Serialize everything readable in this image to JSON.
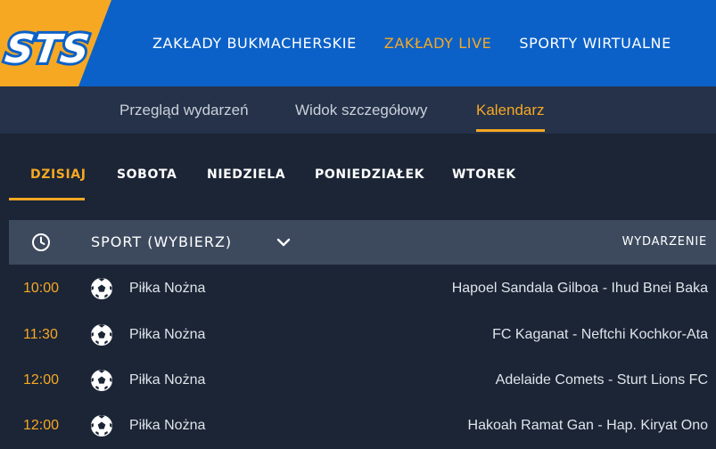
{
  "header": {
    "logo_text": "STS",
    "nav": [
      {
        "label": "ZAKŁADY BUKMACHERSKIE",
        "active": false
      },
      {
        "label": "ZAKŁADY LIVE",
        "active": true
      },
      {
        "label": "SPORTY WIRTUALNE",
        "active": false
      }
    ],
    "colors": {
      "brand_blue": "#0b61c8",
      "accent": "#f7a823"
    }
  },
  "subnav": {
    "items": [
      {
        "label": "Przegląd wydarzeń",
        "active": false
      },
      {
        "label": "Widok szczegółowy",
        "active": false
      },
      {
        "label": "Kalendarz",
        "active": true
      }
    ]
  },
  "days": {
    "tabs": [
      {
        "label": "DZISIAJ",
        "active": true
      },
      {
        "label": "SOBOTA",
        "active": false
      },
      {
        "label": "NIEDZIELA",
        "active": false
      },
      {
        "label": "PONIEDZIAŁEK",
        "active": false
      },
      {
        "label": "WTOREK",
        "active": false
      }
    ]
  },
  "table": {
    "time_icon": "clock-icon",
    "sport_select": "SPORT (WYBIERZ)",
    "event_header": "WYDARZENIE",
    "rows": [
      {
        "time": "10:00",
        "icon": "soccer-ball-icon",
        "sport": "Piłka Nożna",
        "match": "Hapoel Sandala Gilboa - Ihud Bnei Baka"
      },
      {
        "time": "11:30",
        "icon": "soccer-ball-icon",
        "sport": "Piłka Nożna",
        "match": "FC Kaganat - Neftchi Kochkor-Ata"
      },
      {
        "time": "12:00",
        "icon": "soccer-ball-icon",
        "sport": "Piłka Nożna",
        "match": "Adelaide Comets - Sturt Lions FC"
      },
      {
        "time": "12:00",
        "icon": "soccer-ball-icon",
        "sport": "Piłka Nożna",
        "match": "Hakoah Ramat Gan - Hap. Kiryat Ono"
      }
    ]
  }
}
